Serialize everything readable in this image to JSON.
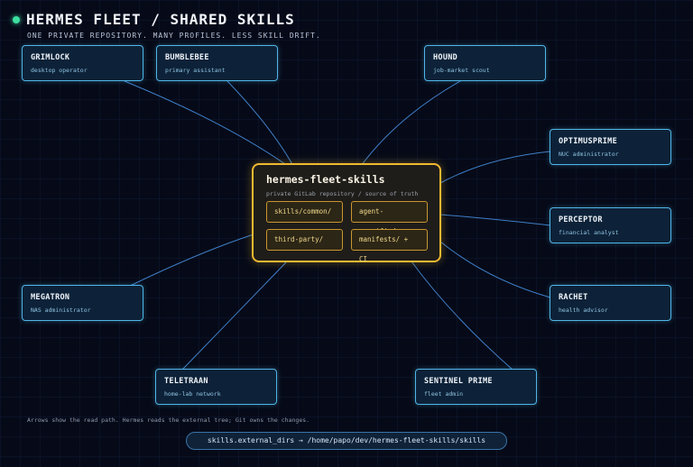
{
  "header": {
    "title": "HERMES FLEET / SHARED SKILLS",
    "subtitle": "ONE PRIVATE REPOSITORY. MANY PROFILES. LESS SKILL DRIFT."
  },
  "hub": {
    "title": "hermes-fleet-skills",
    "subtitle": "private GitLab repository / source of truth",
    "folders": [
      "skills/common/",
      "agent-specific/",
      "third-party/",
      "manifests/ + CI"
    ]
  },
  "nodes": [
    {
      "name": "GRIMLOCK",
      "role": "desktop operator"
    },
    {
      "name": "BUMBLEBEE",
      "role": "primary assistant"
    },
    {
      "name": "HOUND",
      "role": "job-market scout"
    },
    {
      "name": "OPTIMUSPRIME",
      "role": "NUC administrator"
    },
    {
      "name": "PERCEPTOR",
      "role": "financial analyst"
    },
    {
      "name": "RACHET",
      "role": "health advisor"
    },
    {
      "name": "SENTINEL PRIME",
      "role": "fleet admin"
    },
    {
      "name": "TELETRAAN",
      "role": "home-lab network"
    },
    {
      "name": "MEGATRON",
      "role": "NAS administrator"
    }
  ],
  "footer": {
    "note": "Arrows show the read path. Hermes reads the external tree; Git owns the changes.",
    "config": "skills.external_dirs → /home/papo/dev/hermes-fleet-skills/skills"
  },
  "colors": {
    "background": "#060a18",
    "node_border": "#4fb6e8",
    "hub_border": "#f0b930",
    "edge": "#3f7fc8",
    "status_dot": "#3de0a0"
  }
}
